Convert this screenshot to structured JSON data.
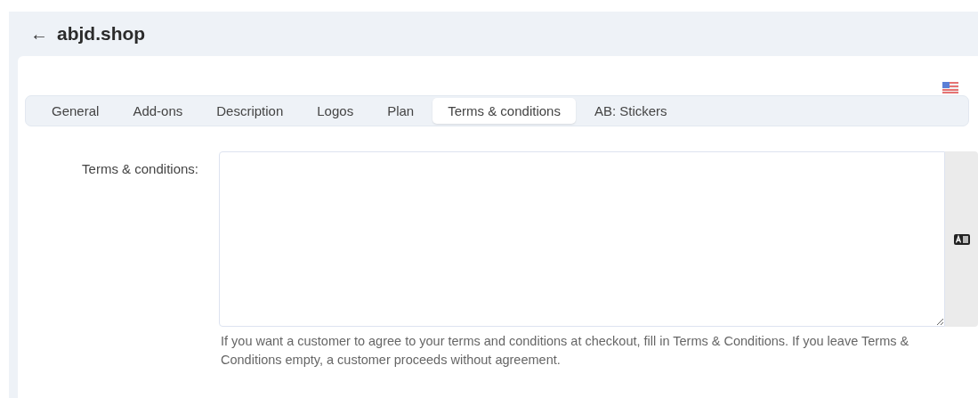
{
  "header": {
    "back": "←",
    "title": "abjd.shop"
  },
  "tabs": [
    {
      "label": "General",
      "selected": false
    },
    {
      "label": "Add-ons",
      "selected": false
    },
    {
      "label": "Description",
      "selected": false
    },
    {
      "label": "Logos",
      "selected": false
    },
    {
      "label": "Plan",
      "selected": false
    },
    {
      "label": "Terms & conditions",
      "selected": true
    },
    {
      "label": "AB: Stickers",
      "selected": false
    }
  ],
  "field": {
    "label": "Terms & conditions:",
    "help": "If you want a customer to agree to your terms and conditions at checkout, fill in Terms & Conditions. If you leave Terms & Conditions empty, a customer proceeds without agreement."
  }
}
